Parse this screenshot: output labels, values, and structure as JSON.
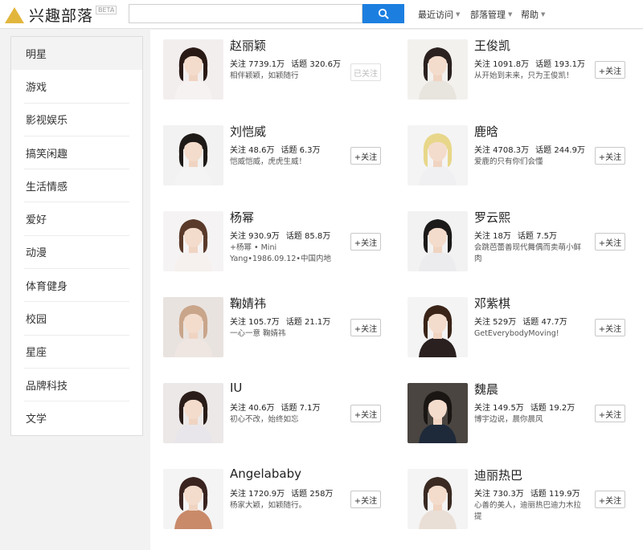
{
  "header": {
    "logo_text": "兴趣部落",
    "logo_badge": "BETA",
    "search_placeholder": "",
    "nav": [
      {
        "label": "最近访问"
      },
      {
        "label": "部落管理"
      },
      {
        "label": "帮助"
      }
    ]
  },
  "sidebar": {
    "items": [
      {
        "label": "明星"
      },
      {
        "label": "游戏"
      },
      {
        "label": "影视娱乐"
      },
      {
        "label": "搞笑闲趣"
      },
      {
        "label": "生活情感"
      },
      {
        "label": "爱好"
      },
      {
        "label": "动漫"
      },
      {
        "label": "体育健身"
      },
      {
        "label": "校园"
      },
      {
        "label": "星座"
      },
      {
        "label": "品牌科技"
      },
      {
        "label": "文学"
      }
    ]
  },
  "cards": [
    {
      "name": "赵丽颖",
      "followers": "关注 7739.1万",
      "topics": "话题 320.6万",
      "desc": "相伴颖颖，如颖随行",
      "button": "已关注",
      "followed": true,
      "avatar_bg": "#f3eeee",
      "hair": "#2a1a16",
      "shirt": "#f6f2f2"
    },
    {
      "name": "王俊凯",
      "followers": "关注 1091.8万",
      "topics": "话题 193.1万",
      "desc": "从开始到未来，只为王俊凯！",
      "button": "+关注",
      "followed": false,
      "avatar_bg": "#f3f1ee",
      "hair": "#2b2220",
      "shirt": "#e8e4de"
    },
    {
      "name": "刘恺威",
      "followers": "关注 48.6万",
      "topics": "话题 6.3万",
      "desc": "恺威恺威，虎虎生威！",
      "button": "+关注",
      "followed": false,
      "avatar_bg": "#f2f2f2",
      "hair": "#1e1a18",
      "shirt": "#f4f4f4"
    },
    {
      "name": "鹿晗",
      "followers": "关注 4708.3万",
      "topics": "话题 244.9万",
      "desc": "爱鹿的只有你们会懂",
      "button": "+关注",
      "followed": false,
      "avatar_bg": "#f4f4f4",
      "hair": "#e8d78a",
      "shirt": "#f0f0f2"
    },
    {
      "name": "杨幂",
      "followers": "关注 930.9万",
      "topics": "话题 85.8万",
      "desc": "+杨幂 • Mini Yang•1986.09.12•中国内地",
      "button": "+关注",
      "followed": false,
      "avatar_bg": "#f5f3f3",
      "hair": "#5a3a2a",
      "shirt": "#f6f0ee"
    },
    {
      "name": "罗云熙",
      "followers": "关注 18万",
      "topics": "话题 7.5万",
      "desc": "会跳芭蕾善现代舞偶而卖萌小鲜肉",
      "button": "+关注",
      "followed": false,
      "avatar_bg": "#f2f2f2",
      "hair": "#1d1a1a",
      "shirt": "#ecebee"
    },
    {
      "name": "鞠婧祎",
      "followers": "关注 105.7万",
      "topics": "话题 21.1万",
      "desc": "一心一意 鞠婧祎",
      "button": "+关注",
      "followed": false,
      "avatar_bg": "#e9e3df",
      "hair": "#c9a58a",
      "shirt": "#efe6e2"
    },
    {
      "name": "邓紫棋",
      "followers": "关注 529万",
      "topics": "话题 47.7万",
      "desc": "GetEverybodyMoving!",
      "button": "+关注",
      "followed": false,
      "avatar_bg": "#f4f4f4",
      "hair": "#3a2418",
      "shirt": "#2a2020"
    },
    {
      "name": "IU",
      "followers": "关注 40.6万",
      "topics": "话题 7.1万",
      "desc": "初心不改，始终如忘",
      "button": "+关注",
      "followed": false,
      "avatar_bg": "#ece8e8",
      "hair": "#2a1c18",
      "shirt": "#e8e6ea"
    },
    {
      "name": "魏晨",
      "followers": "关注 149.5万",
      "topics": "话题 19.2万",
      "desc": "博宇边说，晨你晨风",
      "button": "+关注",
      "followed": false,
      "avatar_bg": "#4a4540",
      "hair": "#1a1614",
      "shirt": "#1e2a3a"
    },
    {
      "name": "Angelababy",
      "followers": "关注 1720.9万",
      "topics": "话题 258万",
      "desc": "杨家大颖，如颖随行。",
      "button": "+关注",
      "followed": false,
      "avatar_bg": "#f4f4f4",
      "hair": "#3a2420",
      "shirt": "#c98a6a"
    },
    {
      "name": "迪丽热巴",
      "followers": "关注 730.3万",
      "topics": "话题 119.9万",
      "desc": "心善的美人，迪丽热巴迪力木拉提",
      "button": "+关注",
      "followed": false,
      "avatar_bg": "#f4f4f4",
      "hair": "#3a2a22",
      "shirt": "#eadfd6"
    }
  ]
}
